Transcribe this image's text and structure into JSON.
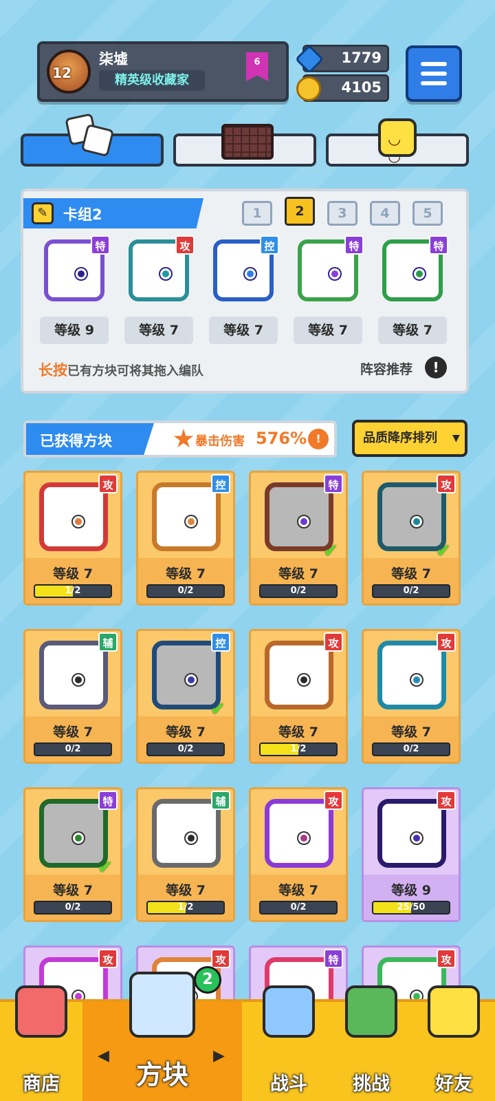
{
  "player": {
    "name": "柒墟",
    "level": "12",
    "title": "精英级收藏家",
    "rank": "6"
  },
  "currency": {
    "gems": "1779",
    "coins": "4105"
  },
  "icons": {
    "menu": "hamburger-icon",
    "gem": "gem-icon",
    "coin": "coin-icon",
    "edit": "pencil-icon",
    "info": "exclamation-icon",
    "crit": "burst-icon"
  },
  "deck": {
    "title": "卡组2",
    "numbers": [
      "1",
      "2",
      "3",
      "4",
      "5"
    ],
    "active_index": 1,
    "slots": [
      {
        "tag": "特",
        "level": "等级 9",
        "frame_color": "#7a4fd1",
        "pip_color": "#2b2090"
      },
      {
        "tag": "攻",
        "level": "等级 7",
        "frame_color": "#2a8f98",
        "pip_color": "#1f9aa6"
      },
      {
        "tag": "控",
        "level": "等级 7",
        "frame_color": "#2a5ec8",
        "pip_color": "#2f7ee8"
      },
      {
        "tag": "特",
        "level": "等级 7",
        "frame_color": "#3aa24a",
        "pip_color": "#8a3fd8"
      },
      {
        "tag": "特",
        "level": "等级 7",
        "frame_color": "#2e9e4a",
        "pip_color": "#2a9a4a"
      }
    ],
    "hint_highlight": "长按",
    "hint_rest": "已有方块可将其拖入编队",
    "recommend": "阵容推荐"
  },
  "collection": {
    "title": "已获得方块",
    "crit_label": "暴击伤害",
    "crit_value": "576%",
    "sort_label": "品质降序排列",
    "cards": [
      {
        "tag": "攻",
        "level": "等级 7",
        "progress_text": "1/2",
        "progress": 0.5,
        "frame_color": "#d23a3a",
        "pip_color": "#e07a3a",
        "checked": false,
        "purple": false
      },
      {
        "tag": "控",
        "level": "等级 7",
        "progress_text": "0/2",
        "progress": 0,
        "frame_color": "#c87a2a",
        "pip_color": "#e0843a",
        "checked": false,
        "purple": false
      },
      {
        "tag": "特",
        "level": "等级 7",
        "progress_text": "0/2",
        "progress": 0,
        "frame_color": "#7a3a2a",
        "pip_color": "#6a3ad8",
        "checked": true,
        "purple": false
      },
      {
        "tag": "攻",
        "level": "等级 7",
        "progress_text": "0/2",
        "progress": 0,
        "frame_color": "#1f5a6a",
        "pip_color": "#1a8a9a",
        "checked": true,
        "purple": false
      },
      {
        "tag": "辅",
        "level": "等级 7",
        "progress_text": "0/2",
        "progress": 0,
        "frame_color": "#5a5a7a",
        "pip_color": "#2a2a2a",
        "checked": false,
        "purple": false
      },
      {
        "tag": "控",
        "level": "等级 7",
        "progress_text": "0/2",
        "progress": 0,
        "frame_color": "#1f4a7a",
        "pip_color": "#3a3aa8",
        "checked": true,
        "purple": false
      },
      {
        "tag": "攻",
        "level": "等级 7",
        "progress_text": "1/2",
        "progress": 0.5,
        "frame_color": "#b8682a",
        "pip_color": "#2a2a2a",
        "checked": false,
        "purple": false
      },
      {
        "tag": "攻",
        "level": "等级 7",
        "progress_text": "0/2",
        "progress": 0,
        "frame_color": "#1f8aa8",
        "pip_color": "#2a8ab8",
        "checked": false,
        "purple": false
      },
      {
        "tag": "特",
        "level": "等级 7",
        "progress_text": "0/2",
        "progress": 0,
        "frame_color": "#1f6a2a",
        "pip_color": "#2a8a2a",
        "checked": true,
        "purple": false
      },
      {
        "tag": "辅",
        "level": "等级 7",
        "progress_text": "1/2",
        "progress": 0.5,
        "frame_color": "#6a6a6a",
        "pip_color": "#2a2a2a",
        "checked": false,
        "purple": false
      },
      {
        "tag": "攻",
        "level": "等级 7",
        "progress_text": "0/2",
        "progress": 0,
        "frame_color": "#8a3ad8",
        "pip_color": "#a83a8a",
        "checked": false,
        "purple": false
      },
      {
        "tag": "攻",
        "level": "等级 9",
        "progress_text": "25/50",
        "progress": 0.5,
        "frame_color": "#2a1a6a",
        "pip_color": "#4a2ab8",
        "checked": false,
        "purple": true
      },
      {
        "tag": "攻",
        "level": "",
        "progress_text": "",
        "progress": 0,
        "frame_color": "#c23ad8",
        "pip_color": "#c23ad8",
        "checked": false,
        "purple": true
      },
      {
        "tag": "攻",
        "level": "",
        "progress_text": "",
        "progress": 0,
        "frame_color": "#e0843a",
        "pip_color": "#e0843a",
        "checked": false,
        "purple": true
      },
      {
        "tag": "特",
        "level": "",
        "progress_text": "",
        "progress": 0,
        "frame_color": "#e03a6a",
        "pip_color": "#6a3ad8",
        "checked": false,
        "purple": true
      },
      {
        "tag": "攻",
        "level": "",
        "progress_text": "",
        "progress": 0,
        "frame_color": "#3ab85a",
        "pip_color": "#3ab85a",
        "checked": false,
        "purple": true
      }
    ]
  },
  "nav": {
    "shop": "商店",
    "blocks": "方块",
    "blocks_badge": "2",
    "battle": "战斗",
    "challenge": "挑战",
    "friends": "好友"
  },
  "colors": {
    "accent_blue": "#2e8bf0",
    "nav_yellow": "#f9c41e",
    "card_gold": "#fbc86a",
    "card_purple": "#e2c9f8"
  }
}
